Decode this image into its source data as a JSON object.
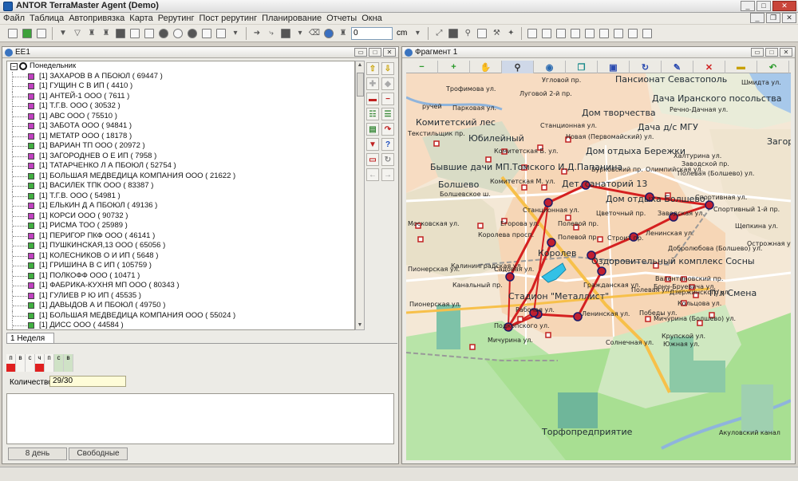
{
  "window": {
    "title": "ANTOR TerraMaster Agent (Demo)",
    "controls": [
      "_",
      "□",
      "✕"
    ]
  },
  "menu": [
    "Файл",
    "Таблица",
    "Автопривязка",
    "Карта",
    "Рерутинг",
    "Пост рерутинг",
    "Планирование",
    "Отчеты",
    "Окна"
  ],
  "toolbar": {
    "distance_value": "0",
    "distance_unit": "cm"
  },
  "left_panel": {
    "title": "ЕЕ1",
    "root": "Понедельник",
    "rows": [
      {
        "text": "[1] ЗАХАРОВ В А ПБОЮЛ ( 69447 )",
        "color": "#c040c0"
      },
      {
        "text": "[1] ГУЩИН С В ИП ( 4410 )",
        "color": "#c040c0"
      },
      {
        "text": "[1] АНТЕЙ-1 ООО ( 7611 )",
        "color": "#c040c0"
      },
      {
        "text": "[1] Т.Г.В. ООО ( 30532 )",
        "color": "#c040c0"
      },
      {
        "text": "[1] АВС ООО ( 75510 )",
        "color": "#c040c0"
      },
      {
        "text": "[1] ЗАБОТА ООО ( 94841 )",
        "color": "#c040c0"
      },
      {
        "text": "[1] МЕТАТР ООО ( 18178 )",
        "color": "#c040c0"
      },
      {
        "text": "[1] ВАРИАН ТП ООО ( 20972 )",
        "color": "#40b040"
      },
      {
        "text": "[1] ЗАГОРОДНЕВ О Е ИП ( 7958 )",
        "color": "#c040c0"
      },
      {
        "text": "[1] ТАТАРЧЕНКО Л А ПБОЮЛ ( 52754 )",
        "color": "#c040c0"
      },
      {
        "text": "[1] БОЛЬШАЯ МЕДВЕДИЦА КОМПАНИЯ ООО ( 21622 )",
        "color": "#40b040"
      },
      {
        "text": "[1] ВАСИЛЕК ТПК ООО ( 83387 )",
        "color": "#40b040"
      },
      {
        "text": "[1] Т.Г.В. ООО ( 54981 )",
        "color": "#40b040"
      },
      {
        "text": "[1] ЕЛЬКИН Д А ПБОЮЛ ( 49136 )",
        "color": "#c040c0"
      },
      {
        "text": "[1] КОРСИ ООО ( 90732 )",
        "color": "#c040c0"
      },
      {
        "text": "[1] РИСМА ТОО ( 25989 )",
        "color": "#40b040"
      },
      {
        "text": "[1] ПЕРИГОР ПКФ ООО ( 46141 )",
        "color": "#c040c0"
      },
      {
        "text": "[1] ПУШКИНСКАЯ,13 ООО ( 65056 )",
        "color": "#40b040"
      },
      {
        "text": "[1] КОЛЕСНИКОВ О И ИП ( 5648 )",
        "color": "#c040c0"
      },
      {
        "text": "[1] ГРИШИНА В С ИП ( 105759 )",
        "color": "#40b040"
      },
      {
        "text": "[1] ПОЛКОФФ ООО ( 10471 )",
        "color": "#40b040"
      },
      {
        "text": "[1] ФАБРИКА-КУХНЯ МП ООО ( 80343 )",
        "color": "#c040c0"
      },
      {
        "text": "[1] ГУЛИЕВ Р Ю ИП ( 45535 )",
        "color": "#c040c0"
      },
      {
        "text": "[1] ДАВЫДОВ А И ПБОЮЛ ( 49750 )",
        "color": "#40b040"
      },
      {
        "text": "[1] БОЛЬШАЯ МЕДВЕДИЦА КОМПАНИЯ ООО ( 55024 )",
        "color": "#40b040"
      },
      {
        "text": "[1] ДИСС ООО ( 44584 )",
        "color": "#40b040"
      }
    ],
    "week_tab": "1 Неделя",
    "days": [
      {
        "label": "п",
        "marked": true
      },
      {
        "label": "в",
        "marked": false
      },
      {
        "label": "с",
        "marked": false
      },
      {
        "label": "ч",
        "marked": true
      },
      {
        "label": "п",
        "marked": false
      },
      {
        "label": "с",
        "marked": false
      },
      {
        "label": "в",
        "marked": false
      }
    ],
    "quantity_label": "Количество",
    "quantity_value": "29/30",
    "bottom_tabs": [
      "8 день",
      "Свободные"
    ]
  },
  "map_panel": {
    "title": "Фрагмент 1",
    "tools": [
      "minus-icon",
      "plus-icon",
      "hand-icon",
      "zoom-icon",
      "globe-icon",
      "copy-icon",
      "grid-icon",
      "refresh-icon",
      "edit-icon",
      "close-icon",
      "ruler-icon",
      "undo-icon"
    ],
    "labels": [
      {
        "text": "Пансионат Севастополь",
        "size": 11
      },
      {
        "text": "Трофимова ул.",
        "size": 8
      },
      {
        "text": "Угловой пр.",
        "size": 8
      },
      {
        "text": "Дача Иранского посольства",
        "size": 11
      },
      {
        "text": "Шмидта ул.",
        "size": 8
      },
      {
        "text": "Луговой 2-й пр.",
        "size": 8
      },
      {
        "text": "Речно-Дачная ул.",
        "size": 8
      },
      {
        "text": "Парковая ул.",
        "size": 8
      },
      {
        "text": "Дом творчества",
        "size": 11
      },
      {
        "text": "ручей",
        "size": 8
      },
      {
        "text": "Комитетский лес",
        "size": 11
      },
      {
        "text": "Станционная ул.",
        "size": 8
      },
      {
        "text": "Дача д/с МГУ",
        "size": 11
      },
      {
        "text": "Текстильщик пр.",
        "size": 8
      },
      {
        "text": "Юбилейный",
        "size": 11
      },
      {
        "text": "Новая (Первомайский) ул.",
        "size": 8
      },
      {
        "text": "Загор",
        "size": 11
      },
      {
        "text": "Комитетская Б. ул.",
        "size": 8
      },
      {
        "text": "Дом отдыха Бережки",
        "size": 11
      },
      {
        "text": "Халтурина ул.",
        "size": 8
      },
      {
        "text": "Заводской пр.",
        "size": 8
      },
      {
        "text": "Бурковский пр.",
        "size": 8
      },
      {
        "text": "Олимпийская ул.",
        "size": 8
      },
      {
        "text": "Полевая (Болшево) ул.",
        "size": 8
      },
      {
        "text": "Болшево",
        "size": 11
      },
      {
        "text": "Бывшие дачи МП.Томского И.Д.Папанина",
        "size": 11
      },
      {
        "text": "Комитетская М. ул.",
        "size": 8
      },
      {
        "text": "Дет. санаторий 13",
        "size": 11
      },
      {
        "text": "Болшевское ш.",
        "size": 8
      },
      {
        "text": "Дом отдыха Болшево",
        "size": 11
      },
      {
        "text": "Спортивная ул.",
        "size": 8
      },
      {
        "text": "Станционная ул.",
        "size": 8
      },
      {
        "text": "Цветочный пр.",
        "size": 8
      },
      {
        "text": "Заводская ул.",
        "size": 8
      },
      {
        "text": "Спортивный 1-й пр.",
        "size": 8
      },
      {
        "text": "Московская ул.",
        "size": 8
      },
      {
        "text": "Егорова ул.",
        "size": 8
      },
      {
        "text": "Полевой пр.",
        "size": 8
      },
      {
        "text": "Щепкина ул.",
        "size": 8
      },
      {
        "text": "Королева просп.",
        "size": 8
      },
      {
        "text": "Полевой пр.",
        "size": 8
      },
      {
        "text": "Строит пр.",
        "size": 8
      },
      {
        "text": "Ленинская ул.",
        "size": 8
      },
      {
        "text": "Острожная ул.",
        "size": 8
      },
      {
        "text": "Королев",
        "size": 11
      },
      {
        "text": "Добролюбова (Болшево) ул.",
        "size": 8
      },
      {
        "text": "Калининградская ул.",
        "size": 8
      },
      {
        "text": "Оздоровительный комплекс Сосны",
        "size": 11
      },
      {
        "text": "Пионерская ул.",
        "size": 8
      },
      {
        "text": "Садовая ул.",
        "size": 8
      },
      {
        "text": "Валентиновский пр.",
        "size": 8
      },
      {
        "text": "Канальный пр.",
        "size": 8
      },
      {
        "text": "Гражданская ул.",
        "size": 8
      },
      {
        "text": "Бонч-Бруевича ул.",
        "size": 8
      },
      {
        "text": "Стадион \"Металлист\"",
        "size": 11
      },
      {
        "text": "Дзержинского ул.",
        "size": 8
      },
      {
        "text": "П/л Смена",
        "size": 11
      },
      {
        "text": "Полевая ул.",
        "size": 8
      },
      {
        "text": "Кольцова ул.",
        "size": 8
      },
      {
        "text": "Рабочая ул.",
        "size": 8
      },
      {
        "text": "Победы ул.",
        "size": 8
      },
      {
        "text": "Ленинская ул.",
        "size": 8
      },
      {
        "text": "Мичурина (Болшево) ул.",
        "size": 8
      },
      {
        "text": "Пионерская ул.",
        "size": 8
      },
      {
        "text": "Подкопского ул.",
        "size": 8
      },
      {
        "text": "Крупской ул.",
        "size": 8
      },
      {
        "text": "Солнечная ул.",
        "size": 8
      },
      {
        "text": "Мичурина ул.",
        "size": 8
      },
      {
        "text": "Южная ул.",
        "size": 8
      },
      {
        "text": "Торфопредприятие",
        "size": 11
      },
      {
        "text": "Акуловский канал",
        "size": 8
      }
    ]
  }
}
